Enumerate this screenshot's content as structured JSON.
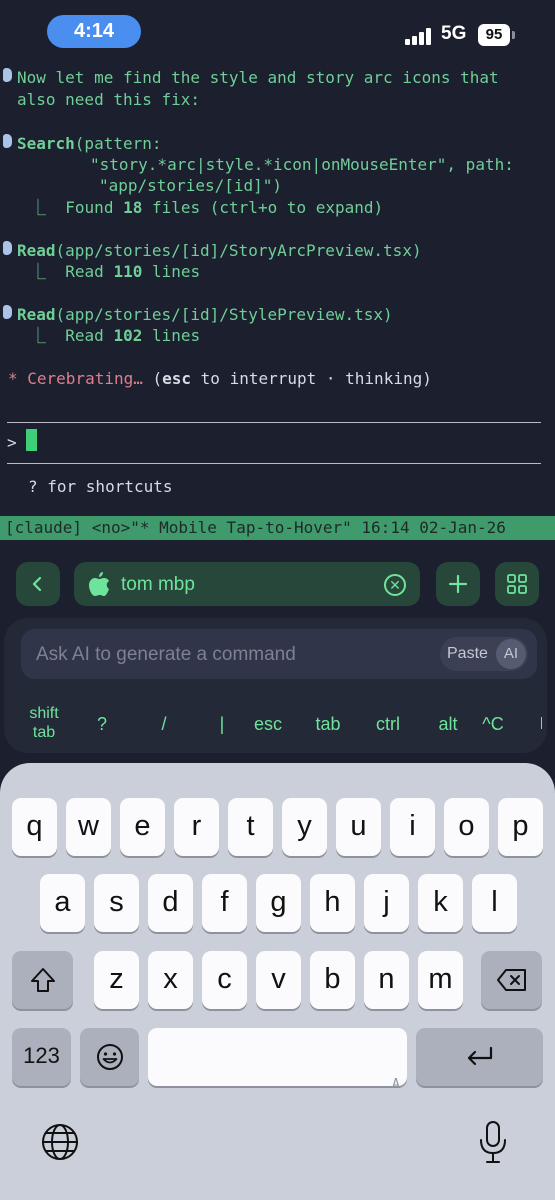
{
  "status_bar": {
    "time": "4:14",
    "network": "5G",
    "battery": "95",
    "colors": {
      "time_pill": "#4a8ff0"
    }
  },
  "terminal": {
    "intro_line1": "Now let me find the style and story arc icons that",
    "intro_line2": "also need this fix:",
    "search": {
      "tool": "Search",
      "line1": "(pattern:",
      "line2": "\"story.*arc|style.*icon|onMouseEnter\", path:",
      "line3": "\"app/stories/[id]\")",
      "result_prefix": "Found ",
      "result_count": "18",
      "result_suffix": " files (ctrl+o to expand)"
    },
    "read1": {
      "tool": "Read",
      "args": "(app/stories/[id]/StoryArcPreview.tsx)",
      "result_prefix": "Read ",
      "result_count": "110",
      "result_suffix": " lines"
    },
    "read2": {
      "tool": "Read",
      "args": "(app/stories/[id]/StylePreview.tsx)",
      "result_prefix": "Read ",
      "result_count": "102",
      "result_suffix": " lines"
    },
    "status": {
      "spinner": "* Cerebrating…",
      "open": " (",
      "key": "esc",
      "rest": " to interrupt · thinking)"
    },
    "prompt_symbol": ">",
    "shortcuts_hint": "? for shortcuts",
    "tmux_status": "[claude] <no>\"* Mobile Tap-to-Hover\" 16:14 02-Jan-26",
    "tree_glyph": "⎿"
  },
  "toolbar": {
    "back_icon": "chevron-left-icon",
    "host_name": "tom mbp",
    "host_icon": "apple-icon",
    "clear_icon": "close-circle-icon",
    "add_icon": "plus-icon",
    "grid_icon": "grid-icon",
    "accent": "#6fe39b"
  },
  "ai_panel": {
    "placeholder": "Ask AI to generate a command",
    "paste_label": "Paste",
    "ai_label": "AI",
    "keys": [
      {
        "line1": "shift",
        "line2": "tab"
      },
      {
        "line1": "?"
      },
      {
        "line1": "/"
      },
      {
        "line1": "|"
      },
      {
        "line1": "esc"
      },
      {
        "line1": "tab"
      },
      {
        "line1": "ctrl"
      },
      {
        "line1": "alt"
      },
      {
        "line1": "^C"
      }
    ]
  },
  "keyboard": {
    "row1": [
      "q",
      "w",
      "e",
      "r",
      "t",
      "y",
      "u",
      "i",
      "o",
      "p"
    ],
    "row2": [
      "a",
      "s",
      "d",
      "f",
      "g",
      "h",
      "j",
      "k",
      "l"
    ],
    "row3": [
      "z",
      "x",
      "c",
      "v",
      "b",
      "n",
      "m"
    ],
    "numbers_key": "123",
    "space_hint": "A",
    "icons": {
      "shift": "shift-icon",
      "delete": "delete-icon",
      "emoji": "emoji-icon",
      "return": "return-icon",
      "globe": "globe-icon",
      "mic": "microphone-icon"
    }
  }
}
